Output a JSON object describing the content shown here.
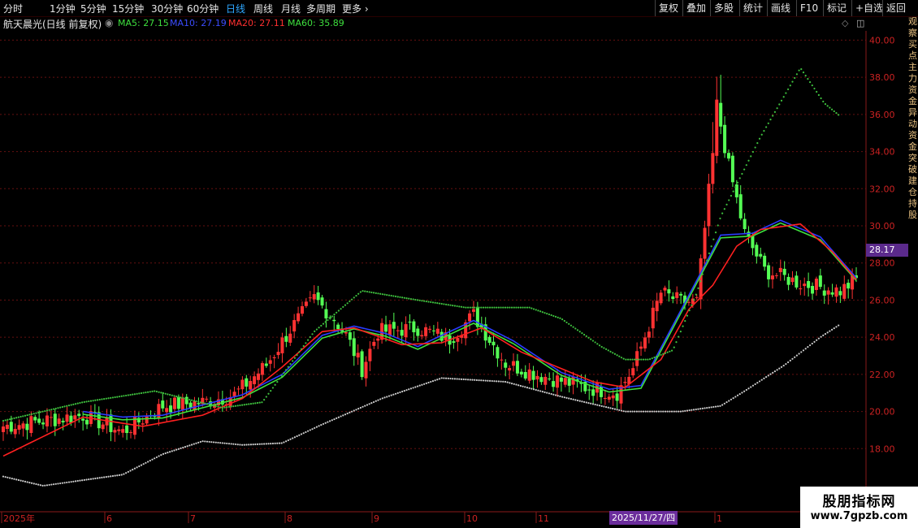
{
  "toolbar": {
    "periods": [
      "分时",
      "1分钟",
      "5分钟",
      "15分钟",
      "30分钟",
      "60分钟",
      "日线",
      "周线",
      "月线",
      "多周期",
      "更多"
    ],
    "active_period": "日线",
    "right_buttons": [
      "复权",
      "叠加",
      "多股",
      "统计",
      "画线",
      "F10",
      "标记",
      "+自选",
      "返回"
    ]
  },
  "header": {
    "stock_name": "航天晨光(日线 前复权)",
    "ma5": "MA5: 27.15",
    "ma10": "MA10: 27.19",
    "ma20": "MA20: 27.11",
    "ma60": "MA60: 35.89"
  },
  "colors": {
    "up": "#ff3232",
    "down": "#54ff54",
    "ma5": "#ffffff",
    "ma10": "#2a3cff",
    "ma20": "#ff2020",
    "ma60": "#3ec03e",
    "lower_band": "#cccccc",
    "grid": "#661111"
  },
  "axis": {
    "y_ticks": [
      "40.00",
      "38.00",
      "36.00",
      "34.00",
      "32.00",
      "30.00",
      "28.00",
      "26.00",
      "24.00",
      "22.00",
      "20.00",
      "18.00"
    ]
  },
  "current_price": "28.17",
  "cursor_date": "2025/11/27/四",
  "right_strip_text": "观察买点主力资金异动资金突破建仓持股",
  "watermark": {
    "line1": "股朋指标网",
    "line2": "www.7gpzb.com"
  },
  "chart_data": {
    "type": "candlestick",
    "title": "航天晨光(日线 前复权)",
    "ylim": [
      16,
      40.5
    ],
    "x_labels": [
      "2025年",
      "6",
      "7",
      "8",
      "9",
      "10",
      "11",
      "1"
    ],
    "anchors": [
      [
        0,
        19.2
      ],
      [
        20,
        19.8
      ],
      [
        30,
        18.9
      ],
      [
        40,
        20.3
      ],
      [
        50,
        20.5
      ],
      [
        58,
        20.9
      ],
      [
        66,
        22.5
      ],
      [
        72,
        24.4
      ],
      [
        78,
        26.1
      ],
      [
        83,
        25.0
      ],
      [
        86,
        24.1
      ],
      [
        90,
        22.3
      ],
      [
        94,
        24.3
      ],
      [
        104,
        24.5
      ],
      [
        112,
        23.9
      ],
      [
        118,
        25.2
      ],
      [
        126,
        22.6
      ],
      [
        134,
        22.0
      ],
      [
        146,
        21.3
      ],
      [
        154,
        21.0
      ],
      [
        158,
        22.3
      ],
      [
        165,
        26.4
      ],
      [
        170,
        25.9
      ],
      [
        174,
        25.9
      ],
      [
        178,
        33.8
      ],
      [
        179,
        36.5
      ],
      [
        182,
        33.2
      ],
      [
        186,
        29.6
      ],
      [
        191,
        27.6
      ],
      [
        200,
        26.9
      ],
      [
        210,
        26.5
      ],
      [
        214,
        27.1
      ]
    ],
    "ma20_anchors": [
      [
        0,
        17.6
      ],
      [
        20,
        19.7
      ],
      [
        35,
        19.2
      ],
      [
        50,
        19.8
      ],
      [
        60,
        20.7
      ],
      [
        70,
        22.4
      ],
      [
        80,
        24.3
      ],
      [
        88,
        24.5
      ],
      [
        100,
        23.6
      ],
      [
        110,
        23.7
      ],
      [
        120,
        24.5
      ],
      [
        130,
        23.2
      ],
      [
        148,
        21.6
      ],
      [
        156,
        21.3
      ],
      [
        165,
        22.8
      ],
      [
        172,
        25.5
      ],
      [
        178,
        26.8
      ],
      [
        184,
        28.9
      ],
      [
        190,
        29.8
      ],
      [
        200,
        30.1
      ],
      [
        208,
        28.6
      ],
      [
        214,
        27.1
      ]
    ],
    "ma10_anchors": [
      [
        20,
        20.0
      ],
      [
        30,
        19.7
      ],
      [
        40,
        19.8
      ],
      [
        60,
        20.9
      ],
      [
        70,
        22.0
      ],
      [
        80,
        24.1
      ],
      [
        88,
        24.6
      ],
      [
        96,
        24.2
      ],
      [
        104,
        23.5
      ],
      [
        118,
        24.9
      ],
      [
        128,
        23.8
      ],
      [
        140,
        22.1
      ],
      [
        152,
        21.2
      ],
      [
        160,
        21.4
      ],
      [
        180,
        29.5
      ],
      [
        188,
        29.6
      ],
      [
        195,
        30.3
      ],
      [
        205,
        29.4
      ],
      [
        214,
        27.2
      ]
    ],
    "ma60_anchors": [
      [
        0,
        19.5
      ],
      [
        20,
        20.5
      ],
      [
        38,
        21.1
      ],
      [
        55,
        20.2
      ],
      [
        65,
        20.5
      ],
      [
        78,
        24.3
      ],
      [
        90,
        26.5
      ],
      [
        104,
        26.0
      ],
      [
        116,
        25.6
      ],
      [
        132,
        25.6
      ],
      [
        140,
        25.0
      ],
      [
        150,
        23.5
      ],
      [
        156,
        22.8
      ],
      [
        162,
        22.8
      ],
      [
        168,
        23.3
      ],
      [
        174,
        26.4
      ],
      [
        180,
        30.5
      ],
      [
        190,
        34.8
      ],
      [
        200,
        38.5
      ],
      [
        206,
        36.6
      ],
      [
        210,
        35.9
      ]
    ],
    "lower_anchors": [
      [
        0,
        16.5
      ],
      [
        10,
        16.0
      ],
      [
        30,
        16.6
      ],
      [
        40,
        17.7
      ],
      [
        50,
        18.4
      ],
      [
        60,
        18.2
      ],
      [
        70,
        18.3
      ],
      [
        80,
        19.3
      ],
      [
        95,
        20.7
      ],
      [
        110,
        21.8
      ],
      [
        126,
        21.6
      ],
      [
        140,
        20.8
      ],
      [
        156,
        20.0
      ],
      [
        170,
        20.0
      ],
      [
        180,
        20.3
      ],
      [
        186,
        21.1
      ],
      [
        196,
        22.5
      ],
      [
        205,
        24.0
      ],
      [
        210,
        24.7
      ]
    ]
  }
}
